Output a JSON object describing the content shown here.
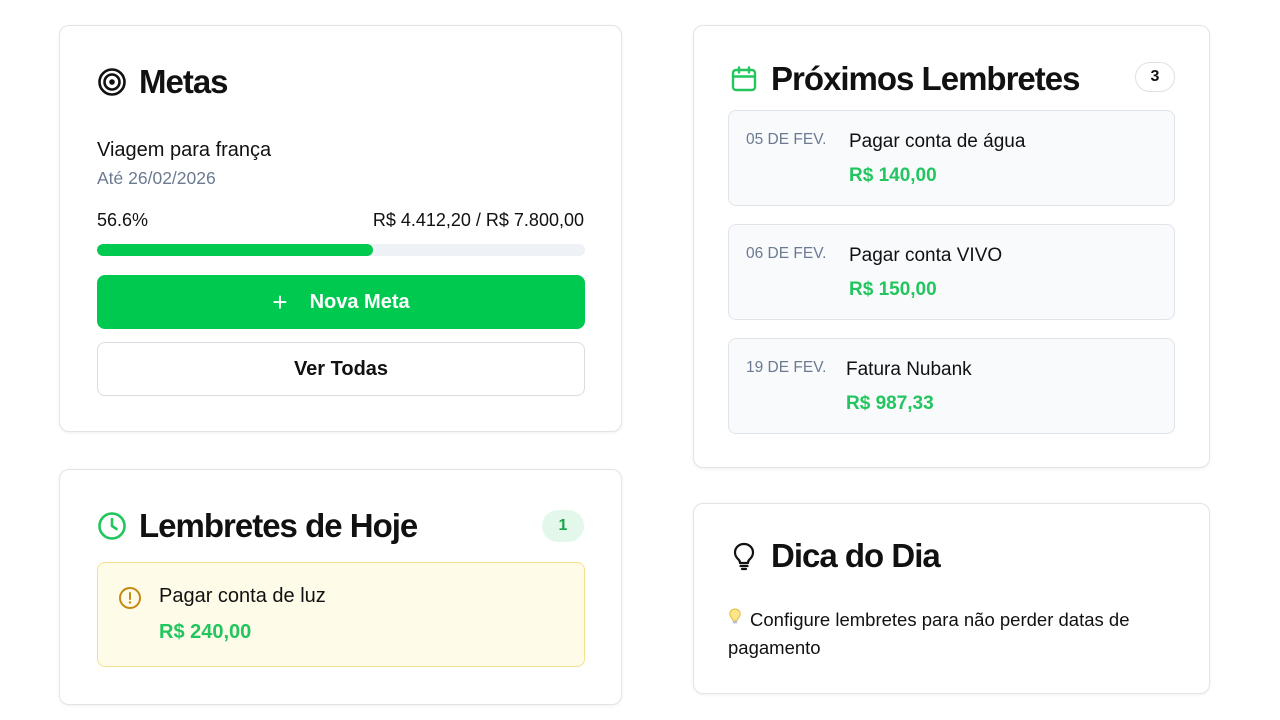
{
  "metas": {
    "title": "Metas",
    "goal": {
      "name": "Viagem para frança",
      "deadline": "Até 26/02/2026",
      "percent_label": "56.6%",
      "progress": 0.566,
      "amounts": "R$ 4.412,20 / R$ 7.800,00"
    },
    "new_button_label": "Nova Meta",
    "view_all_label": "Ver Todas"
  },
  "hoje": {
    "title": "Lembretes de Hoje",
    "count": "1",
    "items": [
      {
        "title": "Pagar conta de luz",
        "amount": "R$ 240,00"
      }
    ]
  },
  "proximos": {
    "title": "Próximos Lembretes",
    "count": "3",
    "items": [
      {
        "date": "05 DE FEV.",
        "title": "Pagar conta de água",
        "amount": "R$ 140,00"
      },
      {
        "date": "06 DE FEV.",
        "title": "Pagar conta VIVO",
        "amount": "R$ 150,00"
      },
      {
        "date": "19 DE FEV.",
        "title": "Fatura Nubank",
        "amount": "R$ 987,33"
      }
    ]
  },
  "dica": {
    "title": "Dica do Dia",
    "text": "Configure lembretes para não perder datas de pagamento"
  },
  "colors": {
    "accent_green": "#00c950",
    "amount_green": "#22c55e",
    "warning_bg": "#fefbe8",
    "warning_border": "#f6e08c",
    "muted_text": "#6b7a90"
  },
  "icons": {
    "metas": "target-icon",
    "hoje": "clock-icon",
    "proximos": "calendar-icon",
    "dica": "lightbulb-icon",
    "warning": "alert-circle-icon",
    "add": "plus-icon"
  }
}
